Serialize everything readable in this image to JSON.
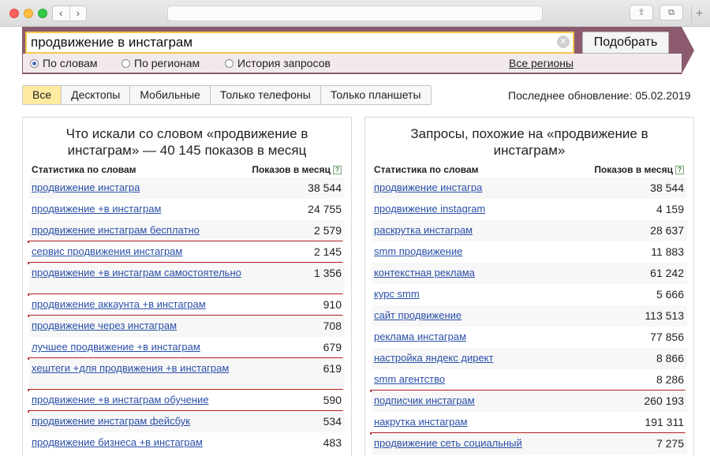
{
  "search": {
    "query": "продвижение в инстаграм",
    "button": "Подобрать"
  },
  "modes": [
    {
      "label": "По словам",
      "selected": true
    },
    {
      "label": "По регионам",
      "selected": false
    },
    {
      "label": "История запросов",
      "selected": false
    }
  ],
  "all_regions": "Все регионы",
  "device_tabs": [
    "Все",
    "Десктопы",
    "Мобильные",
    "Только телефоны",
    "Только планшеты"
  ],
  "last_update": "Последнее обновление: 05.02.2019",
  "left_panel": {
    "title_line1": "Что искали со словом «продвижение в",
    "title_line2": "инстаграм» — 40 145 показов в месяц",
    "col_query": "Статистика по словам",
    "col_count": "Показов в месяц",
    "rows": [
      {
        "q": "продвижение инстагра",
        "n": "38 544"
      },
      {
        "q": "продвижение +в инстаграм",
        "n": "24 755"
      },
      {
        "q": "продвижение инстаграм бесплатно",
        "n": "2 579"
      },
      {
        "q": "сервис продвижения инстаграм",
        "n": "2 145"
      },
      {
        "q": "продвижение +в инстаграм самостоятельно",
        "n": "1 356"
      },
      {
        "q": "продвижение аккаунта +в инстаграм",
        "n": "910"
      },
      {
        "q": "продвижение через инстаграм",
        "n": "708"
      },
      {
        "q": "лучшее продвижение +в инстаграм",
        "n": "679"
      },
      {
        "q": "хештеги +для продвижения +в инстаграм",
        "n": "619"
      },
      {
        "q": "продвижение +в инстаграм обучение",
        "n": "590"
      },
      {
        "q": "продвижение инстаграм фейсбук",
        "n": "534"
      },
      {
        "q": "продвижение бизнеса +в инстаграм",
        "n": "483"
      }
    ]
  },
  "right_panel": {
    "title_line1": "Запросы, похожие на «продвижение в",
    "title_line2": "инстаграм»",
    "col_query": "Статистика по словам",
    "col_count": "Показов в месяц",
    "rows": [
      {
        "q": "продвижение инстагра",
        "n": "38 544"
      },
      {
        "q": "продвижение instagram",
        "n": "4 159"
      },
      {
        "q": "раскрутка инстаграм",
        "n": "28 637"
      },
      {
        "q": "smm продвижение",
        "n": "11 883"
      },
      {
        "q": "контекстная реклама",
        "n": "61 242"
      },
      {
        "q": "курс smm",
        "n": "5 666"
      },
      {
        "q": "сайт продвижение",
        "n": "113 513"
      },
      {
        "q": "реклама инстаграм",
        "n": "77 856"
      },
      {
        "q": "настройка яндекс директ",
        "n": "8 866"
      },
      {
        "q": "smm агентство",
        "n": "8 286"
      },
      {
        "q": "подписчик инстаграм",
        "n": "260 193"
      },
      {
        "q": "накрутка инстаграм",
        "n": "191 311"
      },
      {
        "q": "продвижение сеть социальный",
        "n": "7 275"
      }
    ]
  },
  "colors": {
    "band": "#8c5a6e",
    "link": "#2a4fa8",
    "underline_mark": "#b21f1f",
    "active_tab": "#ffeba0"
  }
}
